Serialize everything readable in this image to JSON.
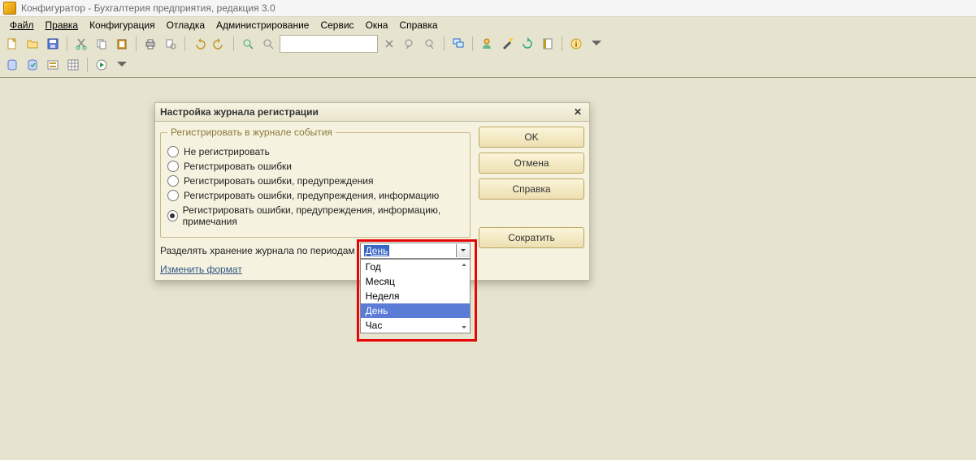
{
  "title": "Конфигуратор - Бухгалтерия предприятия, редакция 3.0",
  "menu": {
    "file": "Файл",
    "edit": "Правка",
    "config": "Конфигурация",
    "debug": "Отладка",
    "admin": "Администрирование",
    "service": "Сервис",
    "windows": "Окна",
    "help": "Справка"
  },
  "dialog": {
    "title": "Настройка журнала регистрации",
    "group_legend": "Регистрировать в журнале события",
    "radios": [
      "Не регистрировать",
      "Регистрировать ошибки",
      "Регистрировать ошибки, предупреждения",
      "Регистрировать ошибки, предупреждения, информацию",
      "Регистрировать ошибки, предупреждения, информацию, примечания"
    ],
    "selected_radio_index": 4,
    "split_label": "Разделять хранение журнала по периодам",
    "period_value": "День",
    "period_options": [
      "Год",
      "Месяц",
      "Неделя",
      "День",
      "Час"
    ],
    "period_selected_index": 3,
    "change_format": "Изменить формат",
    "buttons": {
      "ok": "OK",
      "cancel": "Отмена",
      "help": "Справка",
      "shrink": "Сократить"
    }
  }
}
